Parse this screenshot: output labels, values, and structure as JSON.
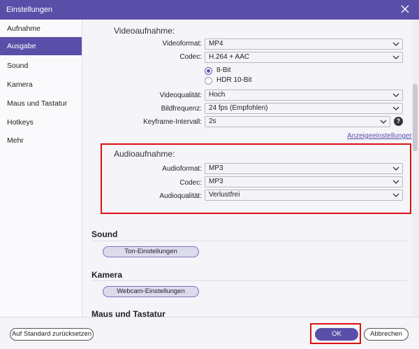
{
  "window": {
    "title": "Einstellungen"
  },
  "sidebar": {
    "items": [
      {
        "label": "Aufnahme"
      },
      {
        "label": "Ausgabe",
        "active": true
      },
      {
        "label": "Sound"
      },
      {
        "label": "Kamera"
      },
      {
        "label": "Maus und Tastatur"
      },
      {
        "label": "Hotkeys"
      },
      {
        "label": "Mehr"
      }
    ]
  },
  "video": {
    "section_title": "Videoaufnahme:",
    "format_label": "Videoformat:",
    "format_value": "MP4",
    "codec_label": "Codec:",
    "codec_value": "H.264 + AAC",
    "bit_option_8": "8-Bit",
    "bit_option_hdr": "HDR 10-Bit",
    "quality_label": "Videoqualität:",
    "quality_value": "Hoch",
    "framerate_label": "Bildfrequenz:",
    "framerate_value": "24 fps (Empfohlen)",
    "keyframe_label": "Keyframe-Intervall:",
    "keyframe_value": "2s",
    "display_settings_link": "Anzeigeeinstellungen"
  },
  "audio": {
    "section_title": "Audioaufnahme:",
    "format_label": "Audioformat:",
    "format_value": "MP3",
    "codec_label": "Codec:",
    "codec_value": "MP3",
    "quality_label": "Audioqualität:",
    "quality_value": "Verlustfrei"
  },
  "sound": {
    "heading": "Sound",
    "button": "Ton-Einstellungen"
  },
  "camera": {
    "heading": "Kamera",
    "button": "Webcam-Einstellungen"
  },
  "mouse": {
    "heading": "Maus und Tastatur"
  },
  "footer": {
    "reset_label": "Auf Standard zurücksetzen",
    "ok_label": "OK",
    "cancel_label": "Abbrechen"
  },
  "colors": {
    "accent": "#5a4fa8",
    "highlight": "#dd1111"
  }
}
